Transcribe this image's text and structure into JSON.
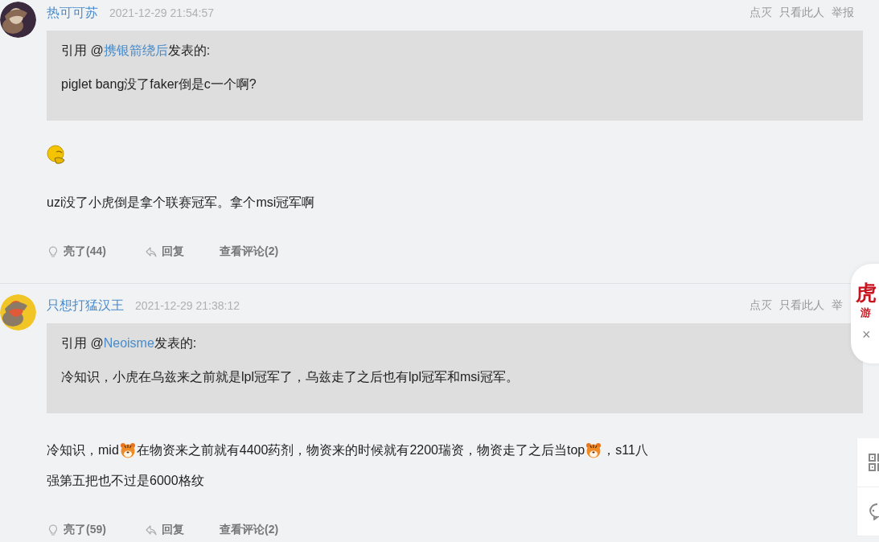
{
  "posts": [
    {
      "author": "热可可苏",
      "time": "2021-12-29 21:54:57",
      "actions": [
        "点灭",
        "只看此人",
        "举报"
      ],
      "quote": {
        "prefix": "引用 @",
        "author": "携银箭绕后",
        "suffix": "发表的:",
        "text": "piglet bang没了faker倒是c一个啊?"
      },
      "content": [
        {
          "kind": "sticker"
        },
        {
          "kind": "paragraph",
          "lines": [
            [
              {
                "kind": "text",
                "text": "uzi没了小虎倒是拿个联赛冠军。拿个msi冠军啊"
              }
            ]
          ]
        }
      ],
      "footer": [
        {
          "kind": "like",
          "label": "亮了(44)"
        },
        {
          "kind": "reply",
          "label": "回复"
        },
        {
          "kind": "comments",
          "label": "查看评论(2)"
        }
      ]
    },
    {
      "author": "只想打猛汉王",
      "time": "2021-12-29 21:38:12",
      "actions": [
        "点灭",
        "只看此人",
        "举"
      ],
      "quote": {
        "prefix": "引用 @",
        "author": "Neoisme",
        "suffix": "发表的:",
        "text": "冷知识，小虎在乌兹来之前就是lpl冠军了，乌兹走了之后也有lpl冠军和msi冠军。"
      },
      "content": [
        {
          "kind": "paragraph",
          "lines": [
            [
              {
                "kind": "text",
                "text": "冷知识，mid"
              },
              {
                "kind": "tiger"
              },
              {
                "kind": "text",
                "text": "在物资来之前就有4400药剂，物资来的时候就有2200瑞资，物资走了之后当top"
              },
              {
                "kind": "tiger"
              },
              {
                "kind": "text",
                "text": "，s11八"
              }
            ],
            [
              {
                "kind": "text",
                "text": "强第五把也不过是6000格纹"
              }
            ]
          ]
        }
      ],
      "footer": [
        {
          "kind": "like",
          "label": "亮了(59)"
        },
        {
          "kind": "reply",
          "label": "回复"
        },
        {
          "kind": "comments",
          "label": "查看评论(2)"
        }
      ]
    }
  ],
  "float_card": {
    "logo": "虎",
    "sub": "游",
    "close": "×"
  },
  "side_tools": [
    {
      "kind": "qr"
    },
    {
      "kind": "chat"
    }
  ]
}
